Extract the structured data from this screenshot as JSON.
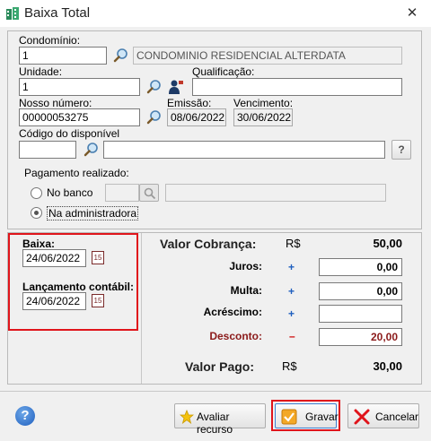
{
  "window": {
    "title": "Baixa Total",
    "close_glyph": "✕"
  },
  "form": {
    "condominio": {
      "label": "Condomínio:",
      "code": "1",
      "name": "CONDOMINIO RESIDENCIAL ALTERDATA"
    },
    "unidade": {
      "label": "Unidade:",
      "value": "1"
    },
    "qualificacao": {
      "label": "Qualificação:",
      "value": ""
    },
    "nosso_numero": {
      "label": "Nosso número:",
      "value": "00000053275"
    },
    "emissao": {
      "label": "Emissão:",
      "value": "08/06/2022"
    },
    "vencimento": {
      "label": "Vencimento:",
      "value": "30/06/2022"
    },
    "codigo_disponivel": {
      "label": "Código do disponível",
      "code": "",
      "name": "",
      "help_glyph": "?"
    },
    "pagamento": {
      "label": "Pagamento realizado:",
      "options": [
        "No banco",
        "Na administradora"
      ],
      "selected": "Na administradora"
    }
  },
  "dates": {
    "baixa": {
      "label": "Baixa:",
      "value": "24/06/2022"
    },
    "lancamento": {
      "label": "Lançamento contábil:",
      "value": "24/06/2022"
    },
    "calendar_glyph": "15"
  },
  "valores": {
    "cobranca": {
      "label": "Valor Cobrança:",
      "currency": "R$",
      "value": "50,00"
    },
    "juros": {
      "label": "Juros:",
      "sign": "+",
      "value": "0,00"
    },
    "multa": {
      "label": "Multa:",
      "sign": "+",
      "value": "0,00"
    },
    "acrescimo": {
      "label": "Acréscimo:",
      "sign": "+",
      "value": ""
    },
    "desconto": {
      "label": "Desconto:",
      "sign": "–",
      "value": "20,00"
    },
    "pago": {
      "label": "Valor Pago:",
      "currency": "R$",
      "value": "30,00"
    }
  },
  "footer": {
    "help_glyph": "?",
    "avaliar": "Avaliar recurso",
    "gravar": "Gravar",
    "cancelar": "Cancelar"
  },
  "colors": {
    "accent_red": "#e0141b",
    "desconto": "#8b1a1a",
    "sign_blue": "#1f5fbf"
  }
}
